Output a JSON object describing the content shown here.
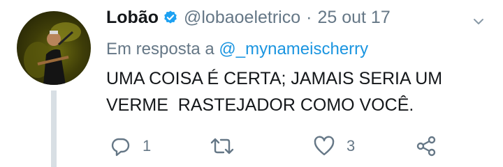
{
  "tweet": {
    "author_name": "Lobão",
    "handle": "@lobaoeletrico",
    "separator": "·",
    "date": "25 out 17",
    "reply_prefix": "Em resposta a",
    "reply_to": "@_mynameischerry",
    "text": "UMA COISA É CERTA; JAMAIS SERIA UM\nVERME  RASTEJADOR COMO VOCÊ.",
    "reply_count": "1",
    "retweet_count": "",
    "like_count": "3"
  },
  "colors": {
    "text": "#14171a",
    "muted": "#657786",
    "link": "#1b95e0",
    "verified": "#1da1f2"
  },
  "icons": [
    "verified-badge-icon",
    "chevron-down-icon",
    "reply-icon",
    "retweet-icon",
    "like-icon",
    "share-icon"
  ]
}
